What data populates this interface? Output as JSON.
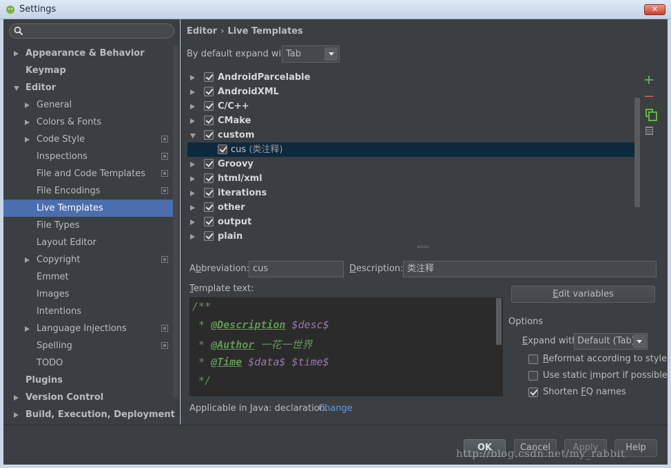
{
  "window": {
    "title": "Settings",
    "close_label": "✕"
  },
  "search": {
    "placeholder": "",
    "value": ""
  },
  "sidebar": {
    "items": [
      {
        "label": "Appearance & Behavior",
        "level": 0,
        "bold": true,
        "arrow": "right",
        "copy_icon": false,
        "selected": false
      },
      {
        "label": "Keymap",
        "level": 0,
        "bold": true,
        "arrow": "none",
        "copy_icon": false,
        "selected": false
      },
      {
        "label": "Editor",
        "level": 0,
        "bold": true,
        "arrow": "down",
        "copy_icon": false,
        "selected": false
      },
      {
        "label": "General",
        "level": 1,
        "bold": false,
        "arrow": "right",
        "copy_icon": false,
        "selected": false
      },
      {
        "label": "Colors & Fonts",
        "level": 1,
        "bold": false,
        "arrow": "right",
        "copy_icon": false,
        "selected": false
      },
      {
        "label": "Code Style",
        "level": 1,
        "bold": false,
        "arrow": "right",
        "copy_icon": true,
        "selected": false
      },
      {
        "label": "Inspections",
        "level": 1,
        "bold": false,
        "arrow": "none",
        "copy_icon": true,
        "selected": false
      },
      {
        "label": "File and Code Templates",
        "level": 1,
        "bold": false,
        "arrow": "none",
        "copy_icon": true,
        "selected": false
      },
      {
        "label": "File Encodings",
        "level": 1,
        "bold": false,
        "arrow": "none",
        "copy_icon": true,
        "selected": false
      },
      {
        "label": "Live Templates",
        "level": 1,
        "bold": false,
        "arrow": "none",
        "copy_icon": false,
        "selected": true
      },
      {
        "label": "File Types",
        "level": 1,
        "bold": false,
        "arrow": "none",
        "copy_icon": false,
        "selected": false
      },
      {
        "label": "Layout Editor",
        "level": 1,
        "bold": false,
        "arrow": "none",
        "copy_icon": false,
        "selected": false
      },
      {
        "label": "Copyright",
        "level": 1,
        "bold": false,
        "arrow": "right",
        "copy_icon": true,
        "selected": false
      },
      {
        "label": "Emmet",
        "level": 1,
        "bold": false,
        "arrow": "none",
        "copy_icon": false,
        "selected": false
      },
      {
        "label": "Images",
        "level": 1,
        "bold": false,
        "arrow": "none",
        "copy_icon": false,
        "selected": false
      },
      {
        "label": "Intentions",
        "level": 1,
        "bold": false,
        "arrow": "none",
        "copy_icon": false,
        "selected": false
      },
      {
        "label": "Language Injections",
        "level": 1,
        "bold": false,
        "arrow": "right",
        "copy_icon": true,
        "selected": false
      },
      {
        "label": "Spelling",
        "level": 1,
        "bold": false,
        "arrow": "none",
        "copy_icon": true,
        "selected": false
      },
      {
        "label": "TODO",
        "level": 1,
        "bold": false,
        "arrow": "none",
        "copy_icon": false,
        "selected": false
      },
      {
        "label": "Plugins",
        "level": 0,
        "bold": true,
        "arrow": "none",
        "copy_icon": false,
        "selected": false
      },
      {
        "label": "Version Control",
        "level": 0,
        "bold": true,
        "arrow": "right",
        "copy_icon": false,
        "selected": false
      },
      {
        "label": "Build, Execution, Deployment",
        "level": 0,
        "bold": true,
        "arrow": "right",
        "copy_icon": false,
        "selected": false
      }
    ]
  },
  "breadcrumb": {
    "part1": "Editor",
    "sep": "›",
    "part2": "Live Templates"
  },
  "expand": {
    "label": "By default expand with",
    "value": "Tab"
  },
  "templates": [
    {
      "name": "AndroidParcelable",
      "desc": "",
      "checked": true,
      "child": false,
      "expanded": false
    },
    {
      "name": "AndroidXML",
      "desc": "",
      "checked": true,
      "child": false,
      "expanded": false
    },
    {
      "name": "C/C++",
      "desc": "",
      "checked": true,
      "child": false,
      "expanded": false
    },
    {
      "name": "CMake",
      "desc": "",
      "checked": true,
      "child": false,
      "expanded": false
    },
    {
      "name": "custom",
      "desc": "",
      "checked": true,
      "child": false,
      "expanded": true
    },
    {
      "name": "cus",
      "desc": "(类注释)",
      "checked": true,
      "child": true,
      "expanded": false
    },
    {
      "name": "Groovy",
      "desc": "",
      "checked": true,
      "child": false,
      "expanded": false
    },
    {
      "name": "html/xml",
      "desc": "",
      "checked": true,
      "child": false,
      "expanded": false
    },
    {
      "name": "iterations",
      "desc": "",
      "checked": true,
      "child": false,
      "expanded": false
    },
    {
      "name": "other",
      "desc": "",
      "checked": true,
      "child": false,
      "expanded": false
    },
    {
      "name": "output",
      "desc": "",
      "checked": true,
      "child": false,
      "expanded": false
    },
    {
      "name": "plain",
      "desc": "",
      "checked": true,
      "child": false,
      "expanded": false
    }
  ],
  "abbreviation": {
    "label_pre": "A",
    "label_u": "b",
    "label_post": "breviation:",
    "value": "cus"
  },
  "description": {
    "label_u": "D",
    "label_post": "escription:",
    "value": "类注释"
  },
  "template_text": {
    "label_u": "T",
    "label_post": "emplate text:",
    "lines": [
      [
        {
          "t": "/**",
          "c": "c-gray"
        }
      ],
      [
        {
          "t": " * ",
          "c": "c-gray"
        },
        {
          "t": "@Description",
          "c": "c-tag"
        },
        {
          "t": " $desc$",
          "c": "c-var"
        }
      ],
      [
        {
          "t": " * ",
          "c": "c-gray"
        },
        {
          "t": "@Author",
          "c": "c-tag"
        },
        {
          "t": " 一花一世界",
          "c": "c-txt"
        }
      ],
      [
        {
          "t": " * ",
          "c": "c-gray"
        },
        {
          "t": "@Time",
          "c": "c-tag"
        },
        {
          "t": " $data$ $time$",
          "c": "c-var"
        }
      ],
      [
        {
          "t": " */",
          "c": "c-gray"
        }
      ]
    ]
  },
  "edit_variables": {
    "label_u": "E",
    "label_post": "dit variables"
  },
  "options": {
    "title": "Options",
    "expand_label_u": "E",
    "expand_label_post": "xpand with",
    "expand_value": "Default (Tab)",
    "reformat": {
      "label_u": "R",
      "label_post": "eformat according to style",
      "checked": false
    },
    "static_import": {
      "label_pre": "Use static ",
      "label_u": "i",
      "label_post": "mport if possible",
      "checked": false
    },
    "shorten": {
      "label_pre": "Shorten ",
      "label_u": "F",
      "label_post": "Q names",
      "checked": true
    }
  },
  "applicable": {
    "text": "Applicable in Java: declaration.",
    "link": "Change"
  },
  "footer": {
    "ok": "OK",
    "cancel": "Cancel",
    "apply": "Apply",
    "help": "Help"
  },
  "watermark": "http://blog.csdn.net/my_rabbit",
  "colors": {
    "selection": "#4b6eaf",
    "background": "#3c3f41",
    "editor_bg": "#2b2b2b",
    "link": "#589df6"
  }
}
